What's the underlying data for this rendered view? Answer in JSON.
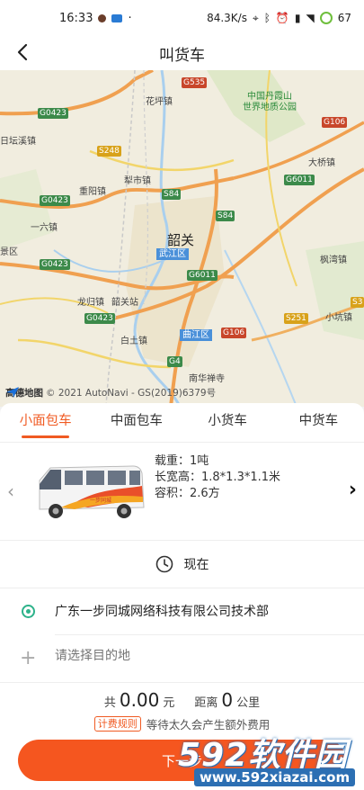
{
  "status_bar": {
    "time": "16:33",
    "network_speed": "84.3K/s",
    "battery": "67",
    "icons": [
      "notification-dot-icon",
      "app-badge-icon",
      "location-icon",
      "bluetooth-icon",
      "alarm-icon",
      "hd-icon",
      "signal-icon",
      "wifi-icon",
      "battery-icon"
    ]
  },
  "header": {
    "title": "叫货车",
    "back_icon": "chevron-left-icon"
  },
  "map": {
    "credit_logo": "高德地图",
    "credit_text": "© 2021 AutoNavi - GS(2019)6379号",
    "labels": {
      "city": "韶关",
      "wujiang": "武江区",
      "qujiang": "曲江区",
      "danxia": "中国丹霞山",
      "danxia2": "世界地质公园",
      "huaping": "花坪镇",
      "lishi": "犁市镇",
      "chongyang": "重阳镇",
      "riyanxi": "日坛溪镇",
      "liuyi": "一六镇",
      "jingqu": "景区",
      "longgui": "龙归镇",
      "shaoguanzhan": "韶关站",
      "baitu": "白土镇",
      "daqiao": "大桥镇",
      "fengwan": "枫湾镇",
      "xiaokeng": "小坑镇",
      "nanhuachan": "南华禅寺"
    },
    "road_shields": {
      "g535": "G535",
      "g0423a": "G0423",
      "g0423b": "G0423",
      "g0423c": "G0423",
      "g0423d": "G0423",
      "g106a": "G106",
      "g106b": "G106",
      "s248": "S248",
      "s84a": "S84",
      "s84b": "S84",
      "g6011a": "G6011",
      "g6011b": "G6011",
      "s251": "S251",
      "g4": "G4",
      "s3": "S3"
    }
  },
  "tabs": [
    "小面包车",
    "中面包车",
    "小货车",
    "中货车"
  ],
  "active_tab": 0,
  "vehicle": {
    "load": "载重：1吨",
    "dimensions": "长宽高：1.8*1.3*1.1米",
    "volume": "容积：2.6方",
    "prev_icon": "chevron-left-icon",
    "next_icon": "chevron-right-icon"
  },
  "time": {
    "label": "现在",
    "icon": "clock-icon"
  },
  "route": {
    "start": "广东一步同城网络科技有限公司技术部",
    "destination_placeholder": "请选择目的地"
  },
  "price": {
    "total_prefix": "共",
    "total": "0.00",
    "total_unit": "元",
    "distance_prefix": "距离",
    "distance": "0",
    "distance_unit": "公里",
    "rule_label": "计费规则",
    "notice": "等待太久会产生额外费用"
  },
  "next_button": "下一步",
  "watermark": {
    "top": "592软件园",
    "bottom": "www.592xiazai.com"
  },
  "colors": {
    "accent": "#f05a22",
    "start_dot": "#2db28a",
    "watermark_blue": "#2c6fb3"
  }
}
